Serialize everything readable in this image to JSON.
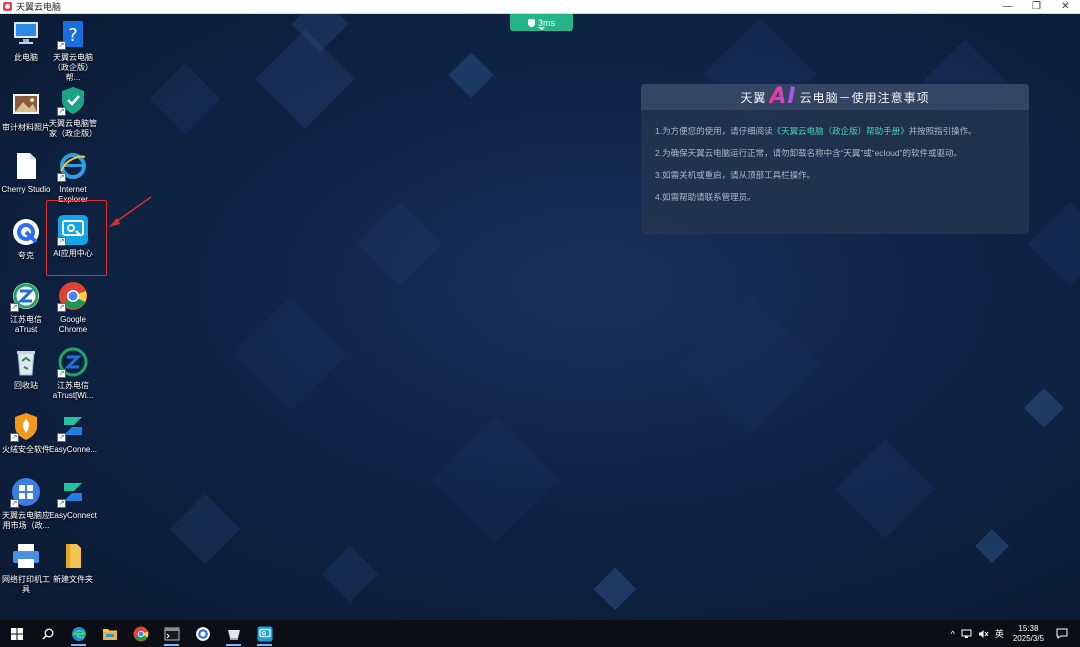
{
  "window": {
    "title": "天翼云电脑",
    "controls": [
      "—",
      "❐",
      "✕"
    ]
  },
  "latency": {
    "text": "3ms"
  },
  "desktop_icons": [
    {
      "label": "此电脑"
    },
    {
      "label": "天翼云电脑（政企版）帮..."
    },
    {
      "label": "审计材料照片"
    },
    {
      "label": "天翼云电脑管家（政企版）"
    },
    {
      "label": "Cherry Studio"
    },
    {
      "label": "Internet Explorer"
    },
    {
      "label": "夸克"
    },
    {
      "label": "AI应用中心"
    },
    {
      "label": "江苏电信aTrust"
    },
    {
      "label": "Google Chrome"
    },
    {
      "label": "回收站"
    },
    {
      "label": "江苏电信aTrust[Wi..."
    },
    {
      "label": "火绒安全软件"
    },
    {
      "label": "EasyConne..."
    },
    {
      "label": "天翼云电脑应用市场（政..."
    },
    {
      "label": "EasyConnect"
    },
    {
      "label": "网络打印机工具"
    },
    {
      "label": "新建文件夹"
    }
  ],
  "notice": {
    "title_pre": "天翼",
    "title_ai": "AI",
    "title_post": "云电脑－使用注意事项",
    "lines": [
      {
        "pre": "1.为方便您的使用，请仔细阅读",
        "link": "《天翼云电脑（政企版）帮助手册》",
        "post": "并按照指引操作。"
      },
      {
        "text": "2.为确保天翼云电脑运行正常，请勿卸载名称中含“天翼”或“ecloud”的软件或驱动。"
      },
      {
        "text": "3.如需关机或重启，请从顶部工具栏操作。"
      },
      {
        "text": "4.如需帮助请联系管理员。"
      }
    ]
  },
  "taskbar": {
    "items": [
      "start-icon",
      "search-icon",
      "edge-icon",
      "file-explorer-icon",
      "chrome-icon",
      "terminal-icon",
      "quark-icon",
      "cloud-pc-icon",
      "ai-center-icon"
    ],
    "tray": {
      "chevron": "^",
      "ime": "英",
      "time": "15:38",
      "date": "2025/3/5"
    }
  },
  "colors": {
    "accent": "#25b389",
    "highlight": "#e02a2a",
    "taskbar": "#0b0e14"
  }
}
